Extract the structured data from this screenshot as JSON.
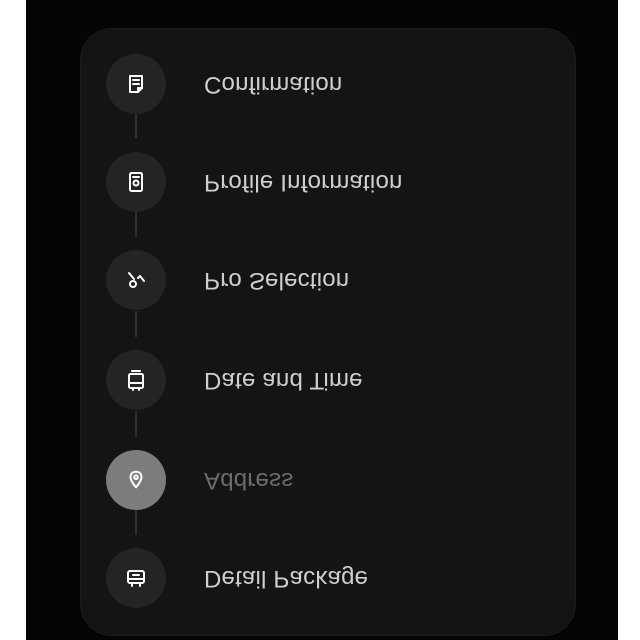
{
  "steps": [
    {
      "label": "Detail Package",
      "icon": "package-icon",
      "active": false
    },
    {
      "label": "Address",
      "icon": "location-drop-icon",
      "active": true
    },
    {
      "label": "Date and Time",
      "icon": "calendar-icon",
      "active": false
    },
    {
      "label": "Pro Selection",
      "icon": "pro-select-icon",
      "active": false
    },
    {
      "label": "Profile Information",
      "icon": "profile-card-icon",
      "active": false
    },
    {
      "label": "Confirmation",
      "icon": "confirmation-icon",
      "active": false
    }
  ],
  "colors": {
    "background": "#050505",
    "panel": "#141414",
    "step_circle": "#242424",
    "active_circle": "#7c7c7c",
    "label": "#cfcfcf",
    "active_label": "#6c6c6c"
  }
}
